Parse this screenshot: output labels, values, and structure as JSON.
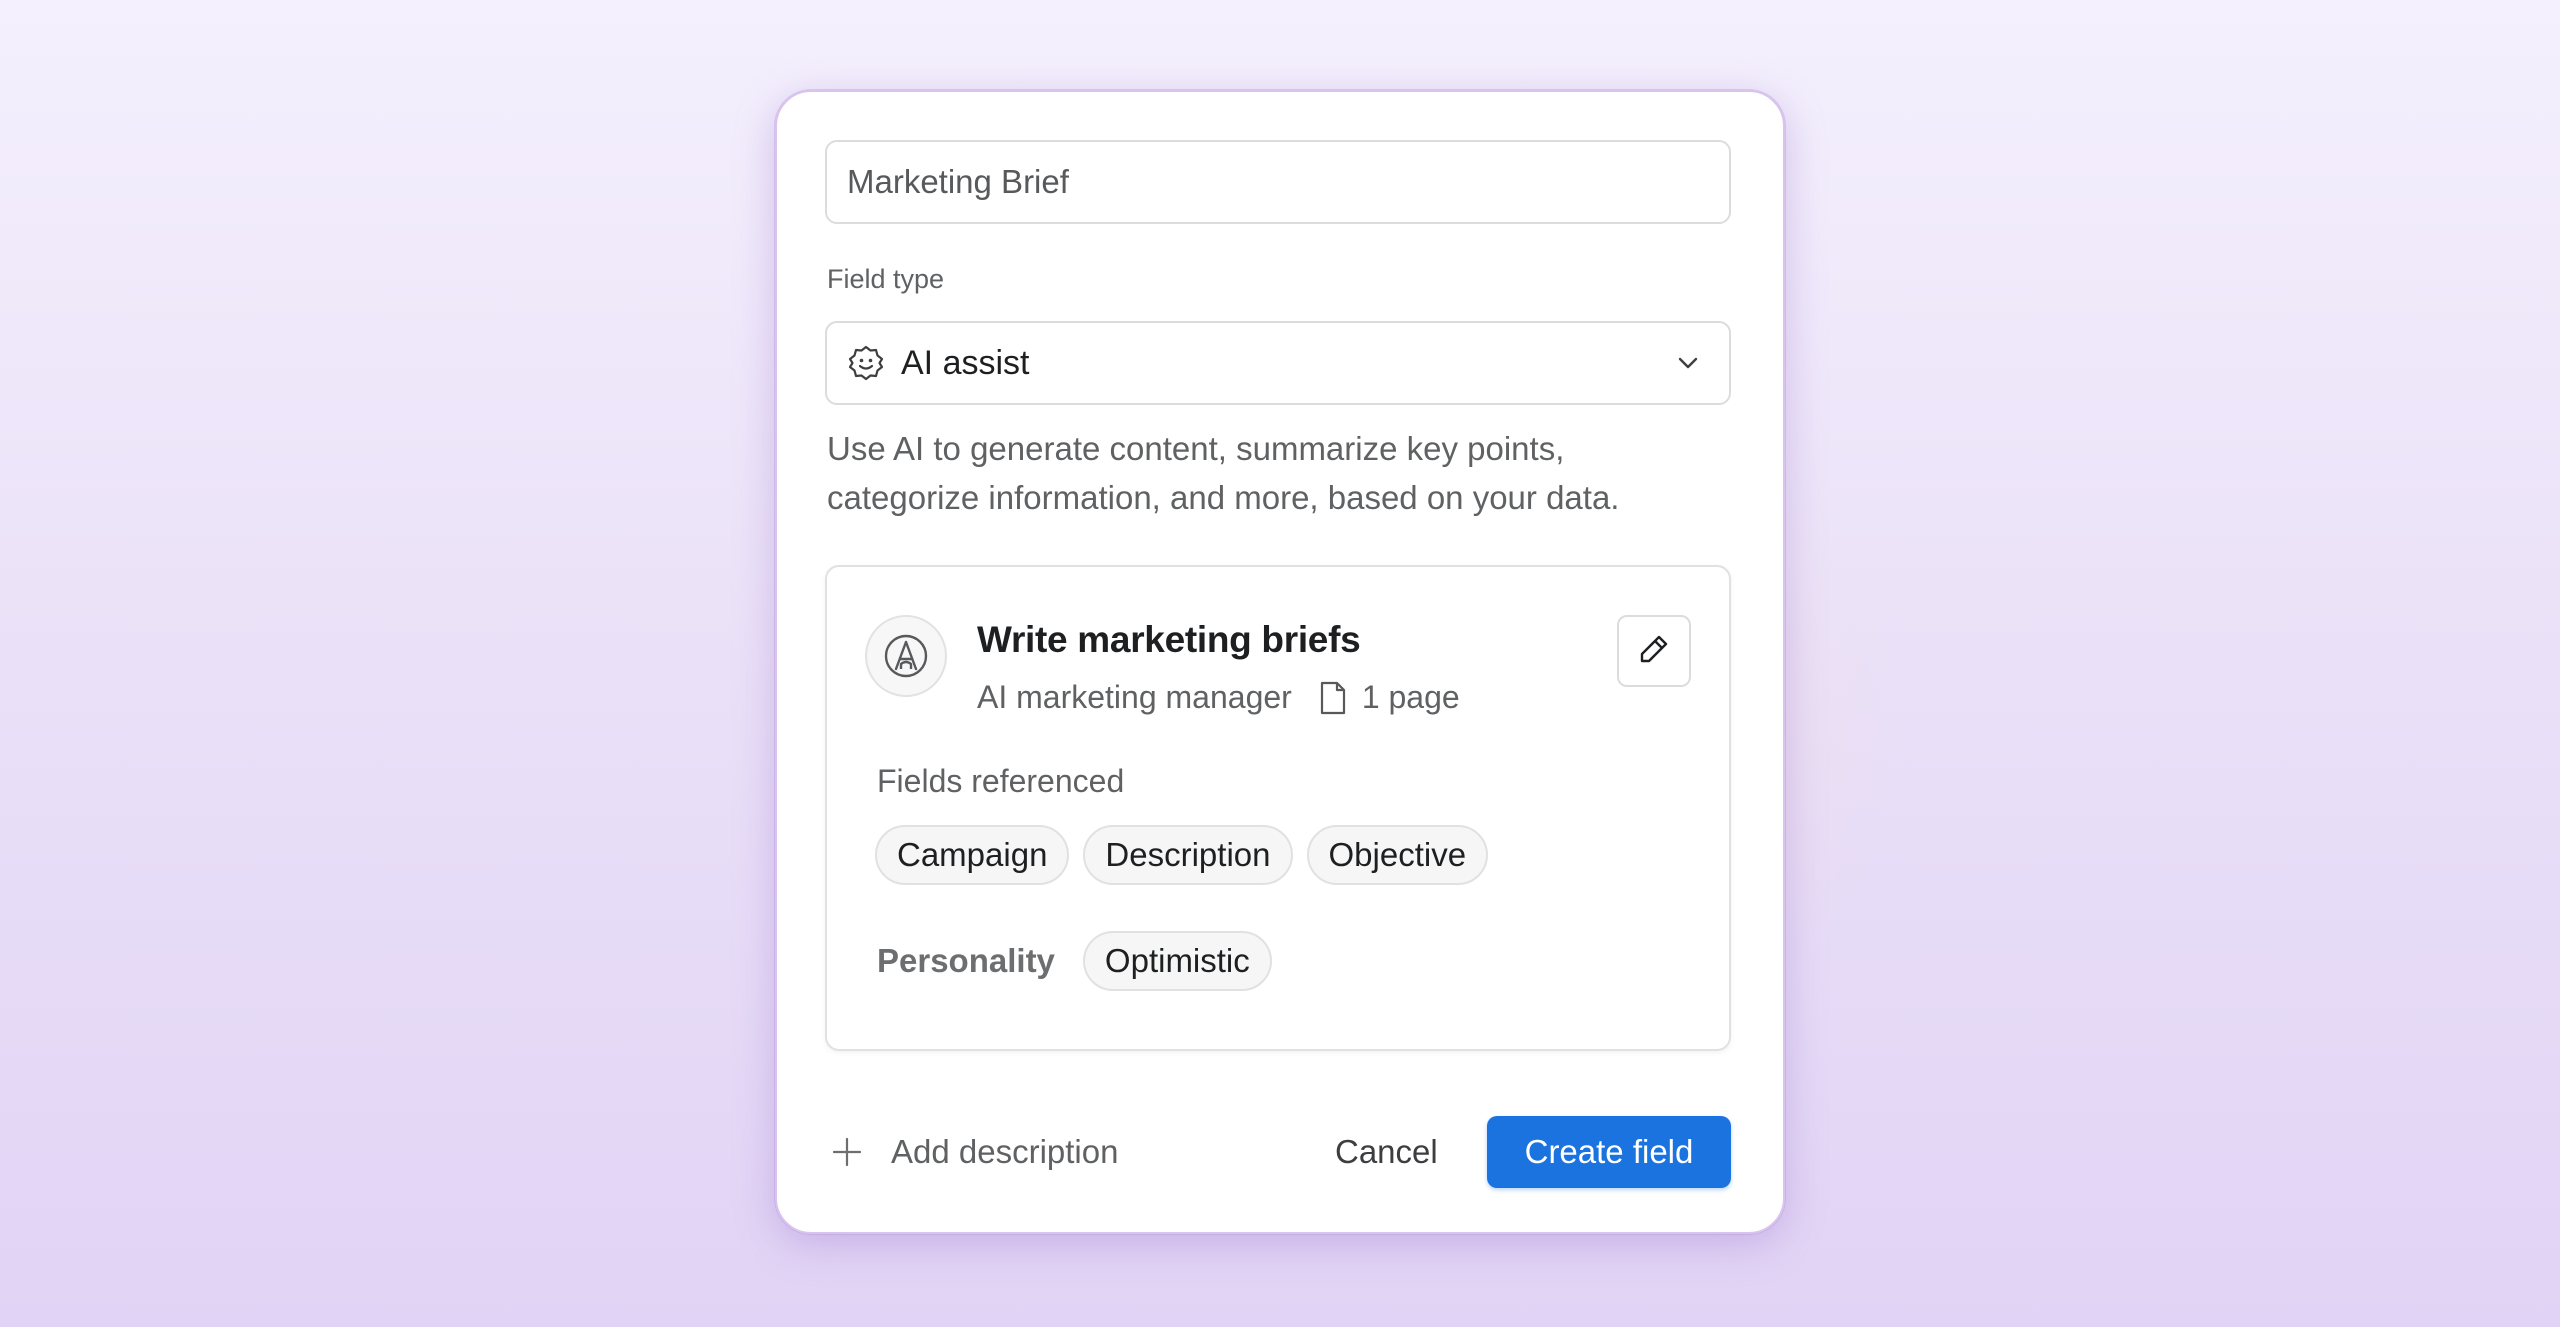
{
  "form": {
    "name_value": "Marketing Brief",
    "field_type_label": "Field type",
    "field_type_value": "AI assist",
    "field_type_icon": "ai-assist-icon",
    "helper_line1": "Use AI to generate content, summarize key points,",
    "helper_line2": "categorize information, and more, based on your data."
  },
  "agent_card": {
    "title": "Write marketing briefs",
    "role": "AI marketing manager",
    "doc_count": "1 page",
    "avatar_icon": "agent-badge-icon",
    "edit_icon": "pencil-icon",
    "fields_label": "Fields referenced",
    "fields": [
      "Campaign",
      "Description",
      "Objective"
    ],
    "personality_label": "Personality",
    "personality_value": "Optimistic"
  },
  "footer": {
    "add_description_label": "Add description",
    "cancel_label": "Cancel",
    "create_label": "Create field"
  },
  "colors": {
    "primary": "#1b73e0",
    "dialog_border": "#d9c4ee",
    "text_secondary": "#5f6163"
  }
}
